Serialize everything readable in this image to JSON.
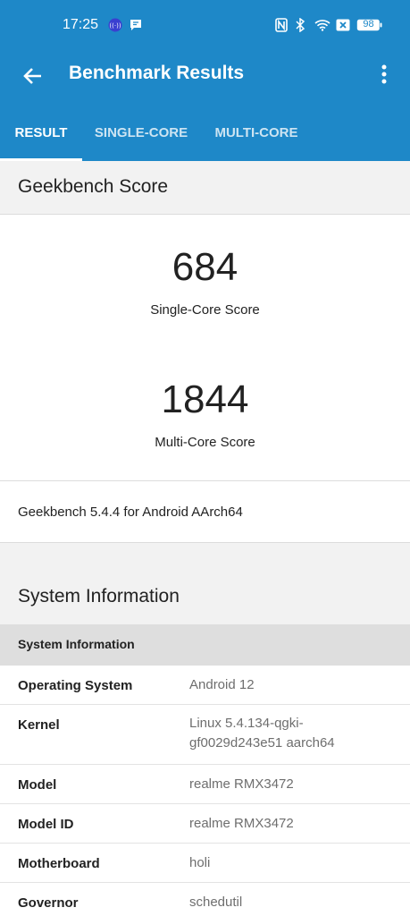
{
  "status_bar": {
    "time": "17:25",
    "battery": "98",
    "icons": [
      "hotspot-icon",
      "message-icon",
      "nfc-icon",
      "bluetooth-icon",
      "wifi-icon",
      "sim-off-icon",
      "battery-icon"
    ]
  },
  "app_bar": {
    "title": "Benchmark Results"
  },
  "tabs": [
    {
      "label": "RESULT",
      "active": true
    },
    {
      "label": "SINGLE-CORE",
      "active": false
    },
    {
      "label": "MULTI-CORE",
      "active": false
    }
  ],
  "geekbench": {
    "section_title": "Geekbench Score",
    "single_core_score": "684",
    "single_core_label": "Single-Core Score",
    "multi_core_score": "1844",
    "multi_core_label": "Multi-Core Score",
    "version": "Geekbench 5.4.4 for Android AArch64"
  },
  "system": {
    "section_title": "System Information",
    "subheader": "System Information",
    "rows": [
      {
        "key": "Operating System",
        "value": "Android 12"
      },
      {
        "key": "Kernel",
        "value": "Linux 5.4.134-qgki-gf0029d243e51 aarch64"
      },
      {
        "key": "Model",
        "value": "realme RMX3472"
      },
      {
        "key": "Model ID",
        "value": "realme RMX3472"
      },
      {
        "key": "Motherboard",
        "value": "holi"
      },
      {
        "key": "Governor",
        "value": "schedutil"
      }
    ]
  },
  "colors": {
    "primary": "#1e88c8",
    "background": "#f2f2f2",
    "subheader": "#dedede"
  }
}
